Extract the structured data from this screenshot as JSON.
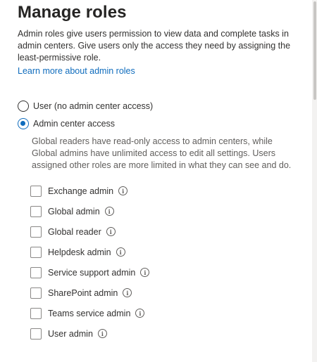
{
  "title": "Manage roles",
  "description": "Admin roles give users permission to view data and complete tasks in admin centers. Give users only the access they need by assigning the least-permissive role.",
  "learn_more": "Learn more about admin roles",
  "radios": [
    {
      "label": "User (no admin center access)",
      "selected": false
    },
    {
      "label": "Admin center access",
      "selected": true
    }
  ],
  "help_text": "Global readers have read-only access to admin centers, while Global admins have unlimited access to edit all settings. Users assigned other roles are more limited in what they can see and do.",
  "info_glyph": "i",
  "roles": [
    {
      "label": "Exchange admin",
      "checked": false
    },
    {
      "label": "Global admin",
      "checked": false
    },
    {
      "label": "Global reader",
      "checked": false
    },
    {
      "label": "Helpdesk admin",
      "checked": false
    },
    {
      "label": "Service support admin",
      "checked": false
    },
    {
      "label": "SharePoint admin",
      "checked": false
    },
    {
      "label": "Teams service admin",
      "checked": false
    },
    {
      "label": "User admin",
      "checked": false
    }
  ],
  "colors": {
    "accent": "#0f6cbd",
    "text": "#323130",
    "muted": "#605e5c"
  }
}
